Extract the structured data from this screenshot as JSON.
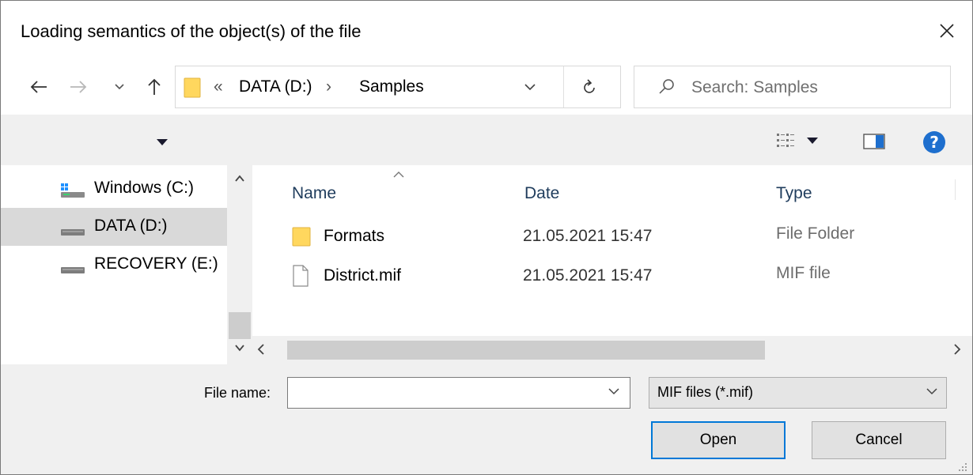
{
  "dialog": {
    "title": "Loading semantics of the object(s) of the file",
    "close_icon": "close-icon"
  },
  "address_bar": {
    "crumb_prefix": "«",
    "crumbs": [
      "DATA (D:)",
      "Samples"
    ],
    "separator": "›",
    "search_placeholder": "Search: Samples"
  },
  "nav_pane": {
    "items": [
      {
        "label": "Windows (C:)",
        "icon": "windows-drive-icon"
      },
      {
        "label": "DATA (D:)",
        "icon": "drive-icon",
        "selected": true
      },
      {
        "label": "RECOVERY (E:)",
        "icon": "drive-icon"
      }
    ]
  },
  "file_list": {
    "columns": [
      "Name",
      "Date",
      "Type"
    ],
    "rows": [
      {
        "name": "Formats",
        "date": "21.05.2021 15:47",
        "type": "File Folder",
        "icon": "folder-icon"
      },
      {
        "name": "District.mif",
        "date": "21.05.2021 15:47",
        "type": "MIF file",
        "icon": "file-icon"
      }
    ]
  },
  "footer": {
    "file_name_label": "File name:",
    "file_name_value": "",
    "filter_value": "MIF files (*.mif)",
    "open_label": "Open",
    "cancel_label": "Cancel"
  },
  "colors": {
    "accent": "#0078d7",
    "folder": "#ffd75e",
    "help": "#1e6fce"
  }
}
